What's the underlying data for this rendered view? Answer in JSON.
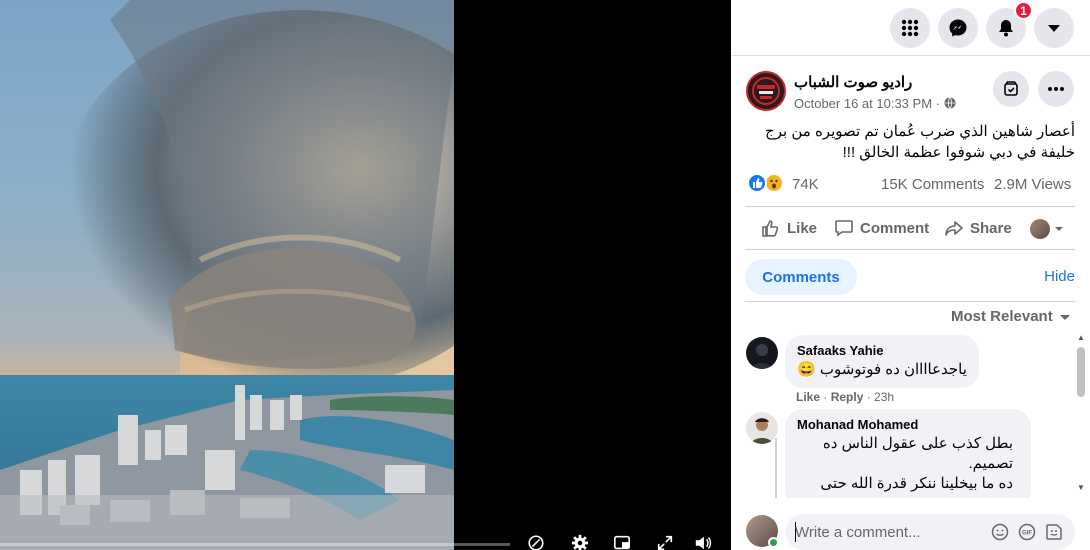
{
  "topbar": {
    "menu_icon": "grid-menu-icon",
    "messenger_icon": "messenger-icon",
    "notifications_icon": "bell-icon",
    "notifications_badge": "1",
    "account_icon": "caret-down-icon"
  },
  "post": {
    "page_name": "راديو صوت الشباب",
    "time": "October 16 at 10:33 PM ·",
    "privacy_icon": "globe-icon",
    "save_icon": "save-icon",
    "more_icon": "more-horizontal-icon",
    "text_line1": "أعصار شاهين الذي ضرب عُمان تم تصويره من برج",
    "text_line2": "خليفة في دبي شوفوا عظمة الخالق !!!",
    "reactions_count": "74K",
    "comments_count": "15K Comments",
    "views_count": "2.9M Views",
    "reaction_types": [
      "like",
      "wow"
    ]
  },
  "actions": {
    "like": "Like",
    "comment": "Comment",
    "share": "Share"
  },
  "comments_panel": {
    "tab_label": "Comments",
    "hide_label": "Hide",
    "sort_label": "Most Relevant",
    "comments": [
      {
        "author": "Safaaks Yahie",
        "text": "ياجدعاااان ده فوتوشوب 😄",
        "like_label": "Like",
        "reply_label": "Reply",
        "time": "23h"
      },
      {
        "author": "Mohanad Mohamed",
        "lines": [
          "بطل كذب على عقول الناس ده",
          "تصميم.",
          "ده ما بيخلينا ننكر قدرة الله حتى"
        ]
      }
    ],
    "composer_placeholder": "Write a comment..."
  },
  "video": {
    "progress_fraction": 0.0
  },
  "colors": {
    "accent": "#1b74e4",
    "badge": "#e41e3f",
    "tab_bg": "#e7f3ff"
  }
}
